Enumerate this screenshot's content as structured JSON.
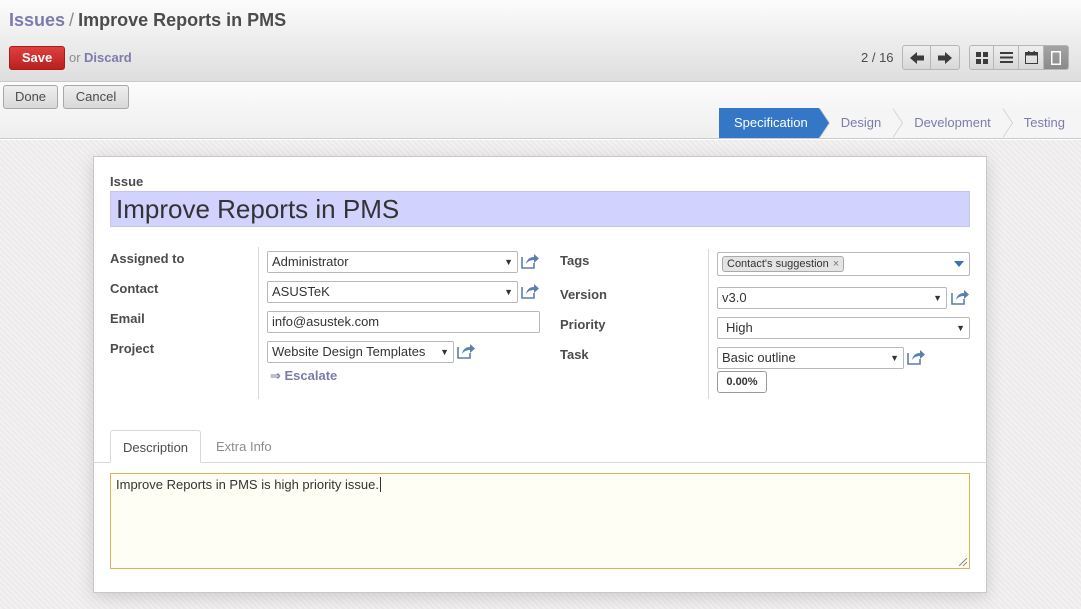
{
  "header": {
    "breadcrumb_parent": "Issues",
    "breadcrumb_separator": "/",
    "breadcrumb_current": "Improve Reports in PMS",
    "save_label": "Save",
    "or_label": "or",
    "discard_label": "Discard",
    "pager_text": "2 / 16"
  },
  "statusbar": {
    "done_label": "Done",
    "cancel_label": "Cancel",
    "stages": [
      "Specification",
      "Design",
      "Development",
      "Testing"
    ],
    "active_stage": "Specification"
  },
  "form": {
    "issue_label": "Issue",
    "issue_title": "Improve Reports in PMS",
    "left": {
      "assigned_to_label": "Assigned to",
      "assigned_to_value": "Administrator",
      "contact_label": "Contact",
      "contact_value": "ASUSTeK",
      "email_label": "Email",
      "email_value": "info@asustek.com",
      "project_label": "Project",
      "project_value": "Website Design Templates",
      "escalate_label": "⇒ Escalate"
    },
    "right": {
      "tags_label": "Tags",
      "tag_value": "Contact's suggestion",
      "version_label": "Version",
      "version_value": "v3.0",
      "priority_label": "Priority",
      "priority_value": "High",
      "task_label": "Task",
      "task_value": "Basic outline",
      "task_progress": "0.00%"
    },
    "tabs": [
      "Description",
      "Extra Info"
    ],
    "description": "Improve Reports in PMS is high priority issue."
  },
  "colors": {
    "accent": "#7c7bad",
    "save_red": "#c9302c",
    "stage_active": "#3577c7",
    "title_bg": "#d2d2ff",
    "focus_border": "#e0b05c"
  },
  "icons": [
    "arrow-left-icon",
    "arrow-right-icon",
    "kanban-view-icon",
    "list-view-icon",
    "calendar-view-icon",
    "form-view-icon",
    "external-link-icon",
    "dropdown-caret-icon",
    "tag-remove-icon"
  ]
}
